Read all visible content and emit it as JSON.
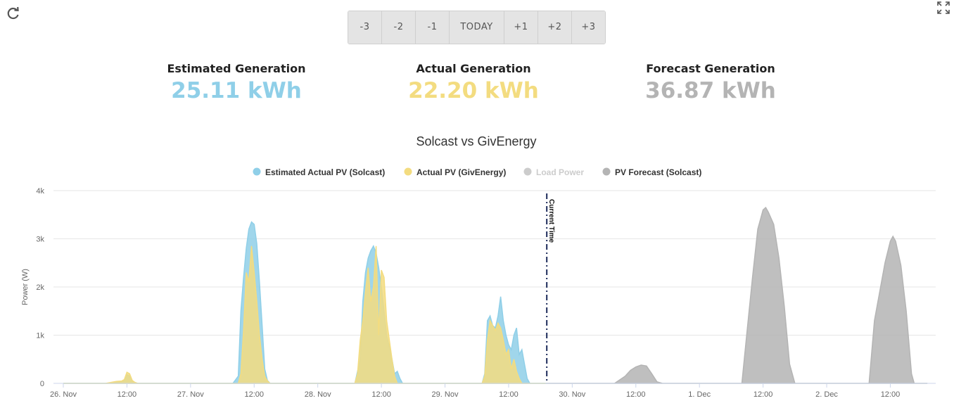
{
  "toolbar": {
    "refresh_icon": "refresh-icon",
    "expand_icon": "expand-icon"
  },
  "day_nav": [
    "-3",
    "-2",
    "-1",
    "TODAY",
    "+1",
    "+2",
    "+3"
  ],
  "stats": [
    {
      "label": "Estimated Generation",
      "value": "25.11 kWh",
      "color": "#8fcfe8"
    },
    {
      "label": "Actual Generation",
      "value": "22.20 kWh",
      "color": "#f3dc80"
    },
    {
      "label": "Forecast Generation",
      "value": "36.87 kWh",
      "color": "#b4b4b4"
    }
  ],
  "chart_data": {
    "type": "area",
    "title": "Solcast vs GivEnergy",
    "ylabel": "Power (W)",
    "ylim": [
      0,
      4000
    ],
    "y_ticks": [
      "0",
      "1k",
      "2k",
      "3k",
      "4k"
    ],
    "x_range_hours": [
      0,
      138
    ],
    "x_ticks": [
      {
        "h": 0,
        "label": "26. Nov"
      },
      {
        "h": 12,
        "label": "12:00"
      },
      {
        "h": 24,
        "label": "27. Nov"
      },
      {
        "h": 36,
        "label": "12:00"
      },
      {
        "h": 48,
        "label": "28. Nov"
      },
      {
        "h": 60,
        "label": "12:00"
      },
      {
        "h": 72,
        "label": "29. Nov"
      },
      {
        "h": 84,
        "label": "12:00"
      },
      {
        "h": 96,
        "label": "30. Nov"
      },
      {
        "h": 108,
        "label": "12:00"
      },
      {
        "h": 120,
        "label": "1. Dec"
      },
      {
        "h": 132,
        "label": "12:00"
      },
      {
        "h": 144,
        "label": "2. Dec"
      },
      {
        "h": 156,
        "label": "12:00"
      }
    ],
    "x_max_hours": 164,
    "current_time": {
      "h": 91.2,
      "label": "Current Time",
      "color": "#1c2a5a"
    },
    "legend": [
      {
        "name": "Estimated Actual PV (Solcast)",
        "color": "#8fcfe8",
        "hidden": false
      },
      {
        "name": "Actual PV (GivEnergy)",
        "color": "#f3dc80",
        "hidden": false
      },
      {
        "name": "Load Power",
        "color": "#cccccc",
        "hidden": true
      },
      {
        "name": "PV Forecast (Solcast)",
        "color": "#b4b4b4",
        "hidden": false
      }
    ],
    "series": [
      {
        "name": "PV Forecast (Solcast)",
        "color": "#b4b4b4",
        "points": [
          [
            91,
            0
          ],
          [
            104,
            0
          ],
          [
            106,
            150
          ],
          [
            107,
            270
          ],
          [
            108,
            340
          ],
          [
            109,
            380
          ],
          [
            110,
            360
          ],
          [
            111,
            200
          ],
          [
            112,
            30
          ],
          [
            113,
            0
          ],
          [
            128,
            0
          ],
          [
            129,
            1100
          ],
          [
            130,
            2200
          ],
          [
            131,
            3200
          ],
          [
            132,
            3600
          ],
          [
            132.5,
            3650
          ],
          [
            133,
            3550
          ],
          [
            134,
            3300
          ],
          [
            135,
            2600
          ],
          [
            136,
            1600
          ],
          [
            137,
            400
          ],
          [
            138,
            0
          ],
          [
            152,
            0
          ],
          [
            153,
            1300
          ],
          [
            154,
            1900
          ],
          [
            155,
            2500
          ],
          [
            156,
            2950
          ],
          [
            156.5,
            3050
          ],
          [
            157,
            2950
          ],
          [
            158,
            2450
          ],
          [
            159,
            1500
          ],
          [
            160,
            200
          ],
          [
            160.5,
            0
          ],
          [
            163,
            0
          ]
        ]
      },
      {
        "name": "Estimated Actual PV (Solcast)",
        "color": "#8fcfe8",
        "points": [
          [
            0,
            0
          ],
          [
            8,
            0
          ],
          [
            9,
            10
          ],
          [
            10,
            20
          ],
          [
            11,
            30
          ],
          [
            11.5,
            60
          ],
          [
            12,
            180
          ],
          [
            12.5,
            150
          ],
          [
            13,
            40
          ],
          [
            14,
            0
          ],
          [
            32,
            0
          ],
          [
            33,
            150
          ],
          [
            33.5,
            1500
          ],
          [
            34,
            2200
          ],
          [
            34.5,
            2800
          ],
          [
            35,
            3200
          ],
          [
            35.5,
            3350
          ],
          [
            36,
            3300
          ],
          [
            36.5,
            2900
          ],
          [
            37,
            2100
          ],
          [
            37.5,
            1200
          ],
          [
            38,
            300
          ],
          [
            38.5,
            60
          ],
          [
            39,
            0
          ],
          [
            55,
            0
          ],
          [
            56,
            500
          ],
          [
            56.5,
            1700
          ],
          [
            57,
            2300
          ],
          [
            57.5,
            2600
          ],
          [
            58,
            2750
          ],
          [
            58.5,
            2850
          ],
          [
            59,
            2700
          ],
          [
            59.5,
            2400
          ],
          [
            60,
            2000
          ],
          [
            60.5,
            1500
          ],
          [
            61,
            1000
          ],
          [
            62,
            500
          ],
          [
            62.5,
            200
          ],
          [
            63,
            250
          ],
          [
            63.5,
            100
          ],
          [
            64,
            0
          ],
          [
            79,
            0
          ],
          [
            79.5,
            200
          ],
          [
            80,
            1300
          ],
          [
            80.5,
            1400
          ],
          [
            81,
            1200
          ],
          [
            81.5,
            1150
          ],
          [
            82,
            1400
          ],
          [
            82.5,
            1800
          ],
          [
            83,
            1300
          ],
          [
            83.5,
            1000
          ],
          [
            84,
            800
          ],
          [
            84.5,
            700
          ],
          [
            85,
            1000
          ],
          [
            85.5,
            1150
          ],
          [
            86,
            600
          ],
          [
            86.5,
            700
          ],
          [
            87,
            400
          ],
          [
            87.5,
            100
          ],
          [
            88,
            0
          ],
          [
            91,
            0
          ]
        ]
      },
      {
        "name": "Actual PV (GivEnergy)",
        "color": "#f3dc80",
        "points": [
          [
            0,
            0
          ],
          [
            8,
            0
          ],
          [
            9,
            20
          ],
          [
            10,
            40
          ],
          [
            11,
            50
          ],
          [
            11.5,
            80
          ],
          [
            12,
            230
          ],
          [
            12.5,
            200
          ],
          [
            13,
            60
          ],
          [
            13.5,
            20
          ],
          [
            14,
            0
          ],
          [
            33,
            0
          ],
          [
            33.5,
            200
          ],
          [
            34,
            1100
          ],
          [
            34.5,
            2300
          ],
          [
            35,
            2100
          ],
          [
            35.5,
            2850
          ],
          [
            36,
            2300
          ],
          [
            36.5,
            1700
          ],
          [
            37,
            1000
          ],
          [
            37.5,
            500
          ],
          [
            38,
            150
          ],
          [
            38.5,
            50
          ],
          [
            39,
            0
          ],
          [
            55,
            0
          ],
          [
            55.5,
            200
          ],
          [
            56,
            900
          ],
          [
            56.5,
            1300
          ],
          [
            57,
            1900
          ],
          [
            57.5,
            2400
          ],
          [
            58,
            1700
          ],
          [
            58.5,
            2000
          ],
          [
            59,
            2850
          ],
          [
            59.5,
            1000
          ],
          [
            60,
            2350
          ],
          [
            60.5,
            2200
          ],
          [
            61,
            1300
          ],
          [
            61.5,
            900
          ],
          [
            62,
            500
          ],
          [
            62.5,
            150
          ],
          [
            63,
            0
          ],
          [
            79,
            0
          ],
          [
            79.5,
            150
          ],
          [
            80,
            900
          ],
          [
            80.5,
            1300
          ],
          [
            81,
            1200
          ],
          [
            81.5,
            1100
          ],
          [
            82,
            1250
          ],
          [
            82.5,
            1150
          ],
          [
            83,
            900
          ],
          [
            83.5,
            600
          ],
          [
            84,
            700
          ],
          [
            84.5,
            300
          ],
          [
            85,
            500
          ],
          [
            85.5,
            250
          ],
          [
            86,
            100
          ],
          [
            86.5,
            0
          ],
          [
            91,
            0
          ]
        ]
      }
    ]
  }
}
